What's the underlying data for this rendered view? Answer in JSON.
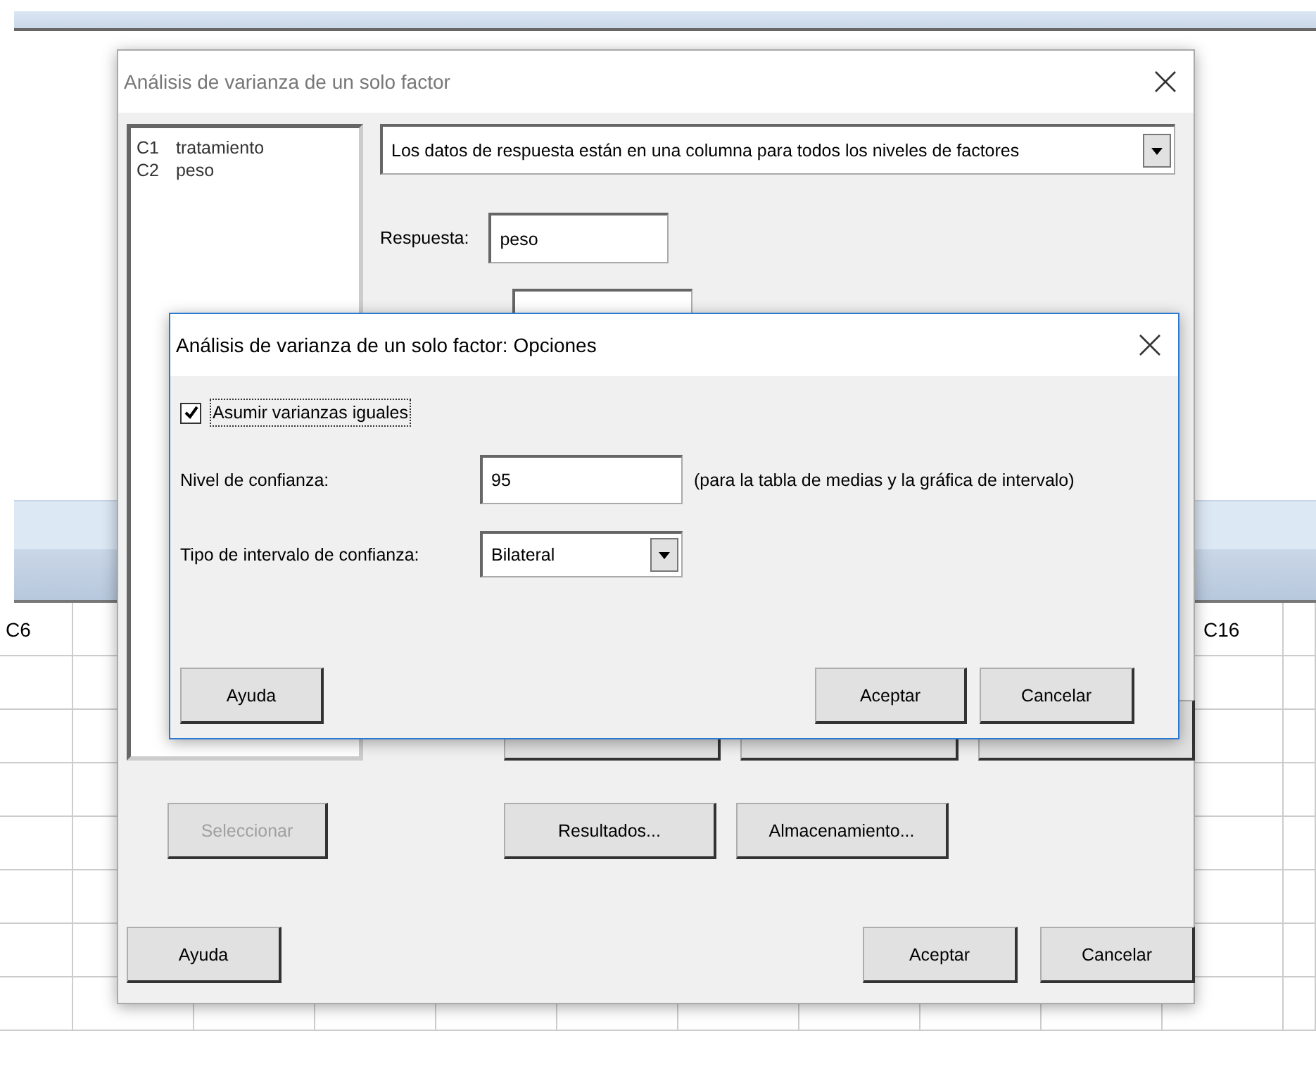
{
  "worksheet": {
    "column_headers": [
      "C6",
      "C16"
    ]
  },
  "main_dialog": {
    "title": "Análisis de varianza de un solo factor",
    "variables": [
      {
        "code": "C1",
        "name": "tratamiento"
      },
      {
        "code": "C2",
        "name": "peso"
      }
    ],
    "data_format": "Los datos de respuesta están en una columna para todos los niveles de factores",
    "response": {
      "label": "Respuesta:",
      "value": "peso"
    },
    "buttons": [
      {
        "label": "Seleccionar",
        "disabled": true
      },
      {
        "label": "Resultados...",
        "disabled": false
      },
      {
        "label": "Almacenamiento...",
        "disabled": false
      }
    ],
    "footer_buttons": [
      "Ayuda",
      "Aceptar",
      "Cancelar"
    ]
  },
  "options_dialog": {
    "title": "Análisis de varianza de un solo factor: Opciones",
    "equal_variances": {
      "label": "Asumir varianzas iguales",
      "checked": true
    },
    "confidence_level": {
      "label": "Nivel de confianza:",
      "value": "95",
      "note": "(para la tabla de medias y la gráfica de intervalo)"
    },
    "interval_type": {
      "label": "Tipo de intervalo de confianza:",
      "value": "Bilateral"
    },
    "footer_buttons": [
      "Ayuda",
      "Aceptar",
      "Cancelar"
    ]
  }
}
